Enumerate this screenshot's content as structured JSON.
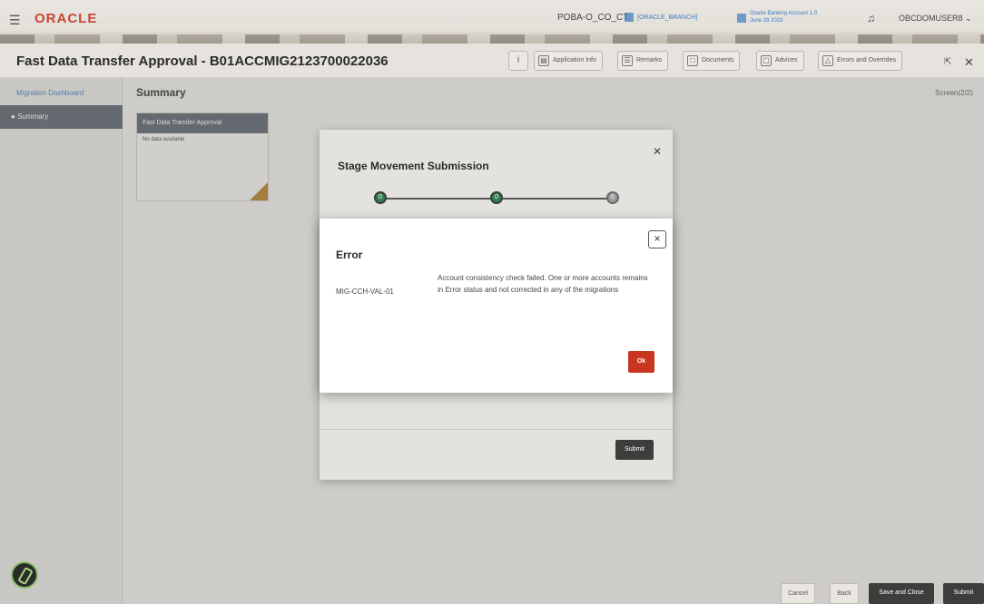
{
  "header": {
    "app_name": "ORACLE",
    "branch_code": "POBA-O_CO_CT",
    "branch_pill": "[ORACLE_BRANCH]",
    "bank_info": "Oracle Banking Account 1.0",
    "bank_date": "June 28 2023",
    "user": "OBCDOMUSER8"
  },
  "titlebar": {
    "title": "Fast Data Transfer Approval - B01ACCMIG2123700022036",
    "buttons": {
      "info": "i",
      "application_info": "Application Info",
      "remarks": "Remarks",
      "documents": "Documents",
      "advices": "Advices",
      "errors_overrides": "Errors and Overrides"
    }
  },
  "sidebar": {
    "items": [
      {
        "label": "Migration Dashboard"
      },
      {
        "label": "Summary"
      }
    ]
  },
  "main": {
    "section_title": "Summary",
    "screen_label": "Screen(2/2)",
    "card": {
      "title": "Fast Data Transfer Approval",
      "body": "No data available"
    }
  },
  "stage_modal": {
    "title": "Stage Movement Submission",
    "submit_label": "Submit",
    "steps": [
      {
        "status": "done",
        "symbol": "0"
      },
      {
        "status": "done",
        "symbol": "0"
      },
      {
        "status": "pending",
        "symbol": "0"
      }
    ]
  },
  "error_modal": {
    "title": "Error",
    "code": "MIG-CCH-VAL-01",
    "message": "Account consistency check failed. One or more accounts remains in Error status and not corrected in any of the migrations",
    "ok_label": "Ok"
  },
  "footer": {
    "cancel": "Cancel",
    "back": "Back",
    "save_close": "Save and Close",
    "submit": "Submit"
  },
  "colors": {
    "brand": "#c74634",
    "ok_button": "#c9361f",
    "dark_button": "#3f3d3b",
    "link": "#3d7bbf"
  }
}
